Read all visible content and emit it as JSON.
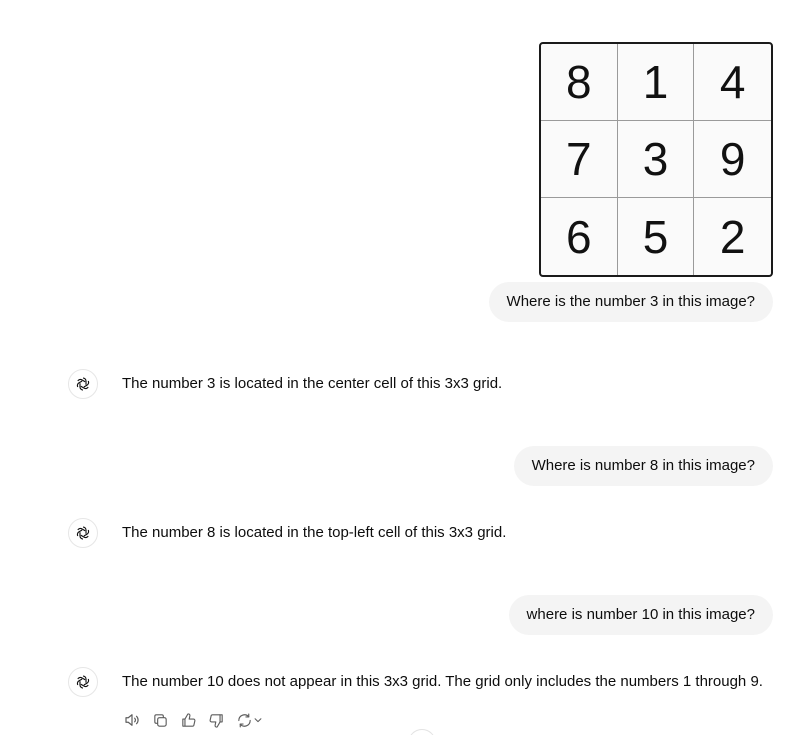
{
  "grid_image": {
    "cells": [
      "8",
      "1",
      "4",
      "7",
      "3",
      "9",
      "6",
      "5",
      "2"
    ]
  },
  "messages": [
    {
      "role": "user",
      "text": "Where is the number 3 in this image?"
    },
    {
      "role": "assistant",
      "text": "The number 3 is located in the center cell of this 3x3 grid."
    },
    {
      "role": "user",
      "text": "Where is number 8 in this image?"
    },
    {
      "role": "assistant",
      "text": "The number 8 is located in the top-left cell of this 3x3 grid."
    },
    {
      "role": "user",
      "text": "where is number 10 in this image?"
    },
    {
      "role": "assistant",
      "text": "The number 10 does not appear in this 3x3 grid. The grid only includes the numbers 1 through 9."
    }
  ],
  "assistant_avatar_icon": "openai-logo-icon",
  "actions": [
    {
      "icon": "speaker-icon",
      "name": "read-aloud-button"
    },
    {
      "icon": "copy-icon",
      "name": "copy-button"
    },
    {
      "icon": "thumbs-up-icon",
      "name": "good-response-button"
    },
    {
      "icon": "thumbs-down-icon",
      "name": "bad-response-button"
    },
    {
      "icon": "regenerate-icon",
      "name": "regenerate-button"
    }
  ],
  "colors": {
    "user_bubble": "#f4f4f4",
    "text": "#0d0d0d",
    "icon": "#5d5d5d"
  }
}
